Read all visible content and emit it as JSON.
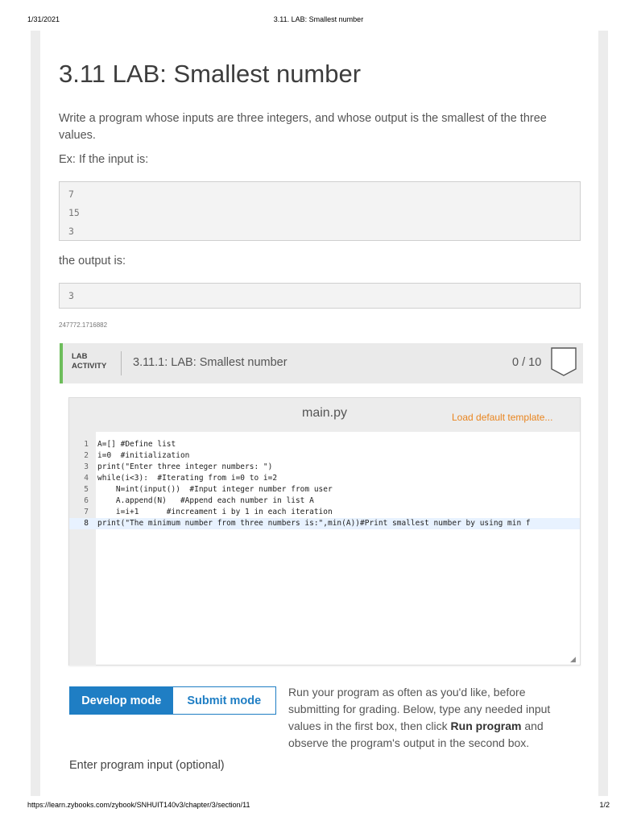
{
  "print_header": {
    "date": "1/31/2021",
    "title": "3.11. LAB: Smallest number"
  },
  "print_footer": {
    "url": "https://learn.zybooks.com/zybook/SNHUIT140v3/chapter/3/section/11",
    "page": "1/2"
  },
  "section": {
    "title": "3.11 LAB: Smallest number",
    "prompt": "Write a program whose inputs are three integers, and whose output is the smallest of the three values.",
    "example_label": "Ex: If the input is:",
    "example_input": [
      "7",
      "15",
      "3"
    ],
    "output_label": "the output is:",
    "example_output": "3",
    "content_id": "247772.1716882"
  },
  "activity": {
    "tag_line1": "LAB",
    "tag_line2": "ACTIVITY",
    "title": "3.11.1: LAB: Smallest number",
    "score": "0 / 10"
  },
  "editor": {
    "file_name": "main.py",
    "load_default": "Load default template...",
    "lines": [
      {
        "n": "1",
        "text": "A=[] #Define list"
      },
      {
        "n": "2",
        "text": "i=0  #initialization"
      },
      {
        "n": "3",
        "text": "print(\"Enter three integer numbers: \")"
      },
      {
        "n": "4",
        "text": "while(i<3):  #Iterating from i=0 to i=2"
      },
      {
        "n": "5",
        "text": "    N=int(input())  #Input integer number from user"
      },
      {
        "n": "6",
        "text": "    A.append(N)   #Append each number in list A"
      },
      {
        "n": "7",
        "text": "    i=i+1      #increament i by 1 in each iteration"
      },
      {
        "n": "8",
        "text": "print(\"The minimum number from three numbers is:\",min(A))#Print smallest number by using min f"
      }
    ],
    "active_line": 8
  },
  "modes": {
    "develop": "Develop mode",
    "submit": "Submit mode",
    "selected": "develop"
  },
  "run_info": {
    "part1": "Run your program as often as you'd like, before submitting for grading. Below, type any needed input values in the first box, then click ",
    "bold": "Run program",
    "part2": " and observe the program's output in the second box."
  },
  "input_label": "Enter program input (optional)",
  "colors": {
    "accent_blue": "#1f7ec4",
    "accent_orange": "#e9851f",
    "activity_green": "#6dbd5b"
  }
}
